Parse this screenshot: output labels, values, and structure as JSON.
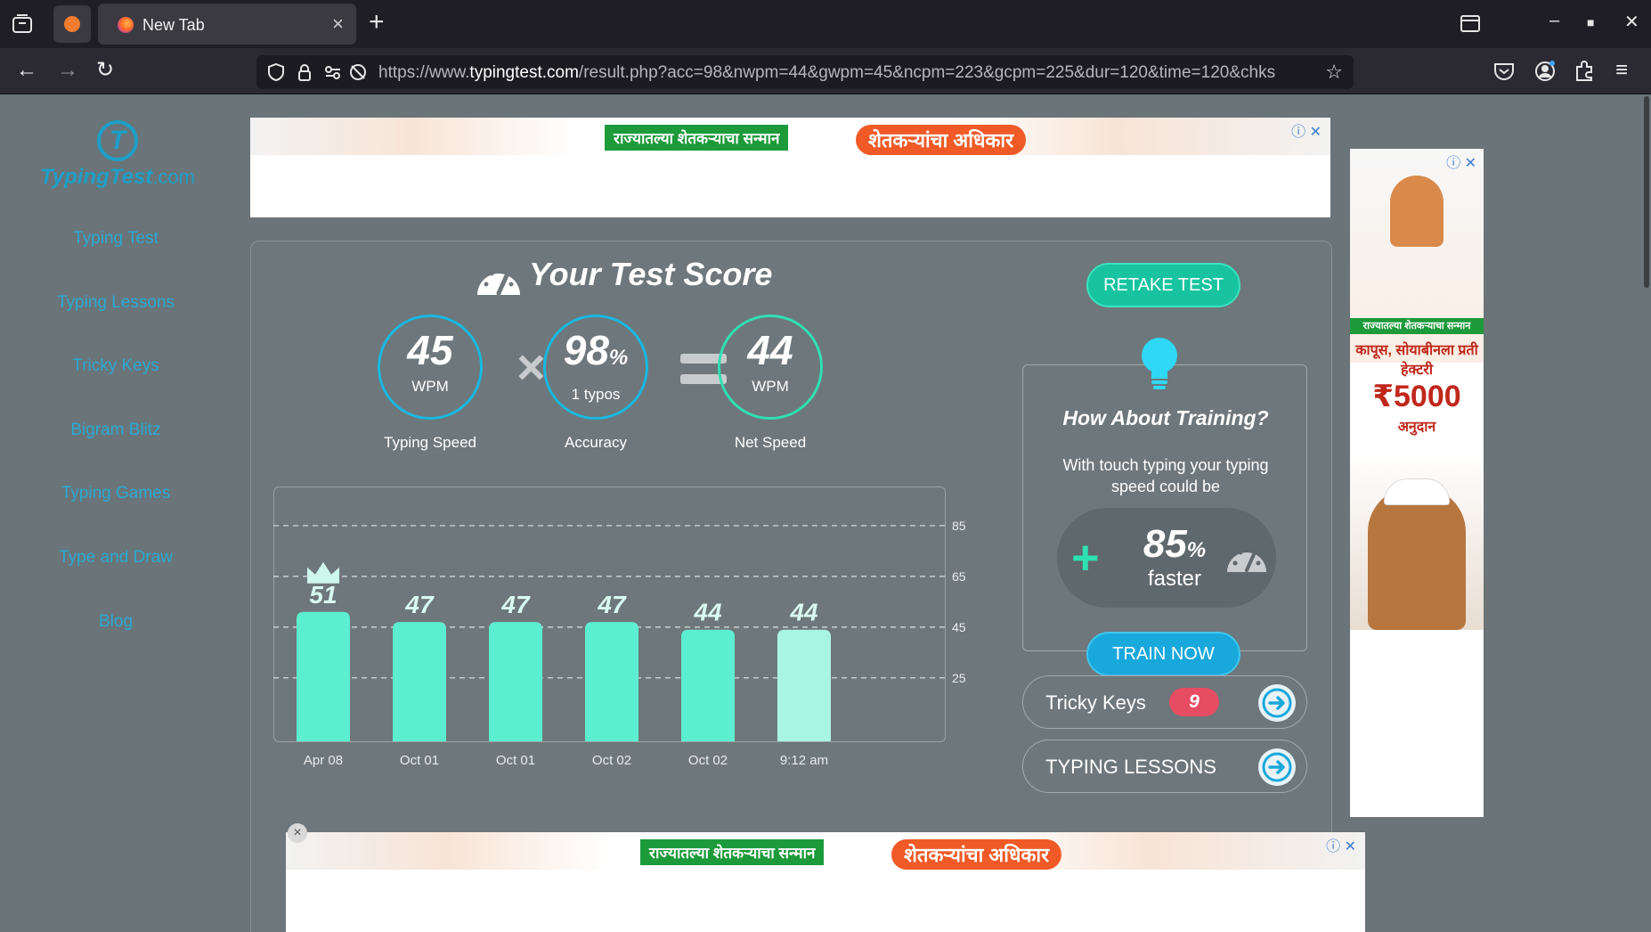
{
  "browser": {
    "tab_title": "New Tab",
    "url_prefix": "https://www.",
    "url_domain": "typingtest.com",
    "url_path": "/result.php?acc=98&nwpm=44&gwpm=45&ncpm=223&gcpm=225&dur=120&time=120&chks"
  },
  "sidebar": {
    "logo_main": "TypingTest",
    "logo_suffix": ".com",
    "items": [
      {
        "label": "Typing Test"
      },
      {
        "label": "Typing Lessons"
      },
      {
        "label": "Tricky Keys"
      },
      {
        "label": "Bigram Blitz"
      },
      {
        "label": "Typing Games"
      },
      {
        "label": "Type and Draw"
      },
      {
        "label": "Blog"
      }
    ]
  },
  "ads": {
    "banner_green": "राज्यातल्या शेतकऱ्याचा सन्मान",
    "banner_orange": "शेतकऱ्यांचा अधिकार",
    "side_band": "राज्यातल्या शेतकऱ्याचा सन्मान",
    "side_line1": "कापूस, सोयाबीनला प्रती हेक्टरी",
    "side_amount": "₹5000",
    "side_line2": "अनुदान"
  },
  "score": {
    "title": "Your Test Score",
    "typing_speed": {
      "value": "45",
      "unit": "WPM",
      "label": "Typing Speed"
    },
    "accuracy": {
      "value": "98",
      "suffix": "%",
      "unit": "1 typos",
      "label": "Accuracy"
    },
    "net_speed": {
      "value": "44",
      "unit": "WPM",
      "label": "Net Speed"
    }
  },
  "chart_data": {
    "type": "bar",
    "categories": [
      "Apr 08",
      "Oct 01",
      "Oct 01",
      "Oct 02",
      "Oct 02",
      "9:12 am"
    ],
    "values": [
      51,
      47,
      47,
      47,
      44,
      44
    ],
    "yticks": [
      25,
      45,
      65,
      85
    ],
    "ylim": [
      0,
      92
    ],
    "grid": true,
    "best_marker_index": 0,
    "colors": {
      "bar": "#5cefcf",
      "latest_bar": "#a8f5e2",
      "crown": "#cdf7ec"
    }
  },
  "actions": {
    "retake": "RETAKE TEST",
    "train_now": "TRAIN NOW"
  },
  "training": {
    "title": "How About Training?",
    "text": "With touch typing your typing speed could be",
    "percent": "85",
    "percent_suffix": "%",
    "faster": "faster"
  },
  "links": {
    "tricky_keys": {
      "label": "Tricky Keys",
      "count": "9"
    },
    "typing_lessons": {
      "label": "TYPING LESSONS"
    }
  },
  "colors": {
    "accent_cyan": "#19b8e1",
    "accent_green": "#2fe0b3",
    "page_bg": "#6b7478",
    "badge_red": "#e74c63"
  }
}
